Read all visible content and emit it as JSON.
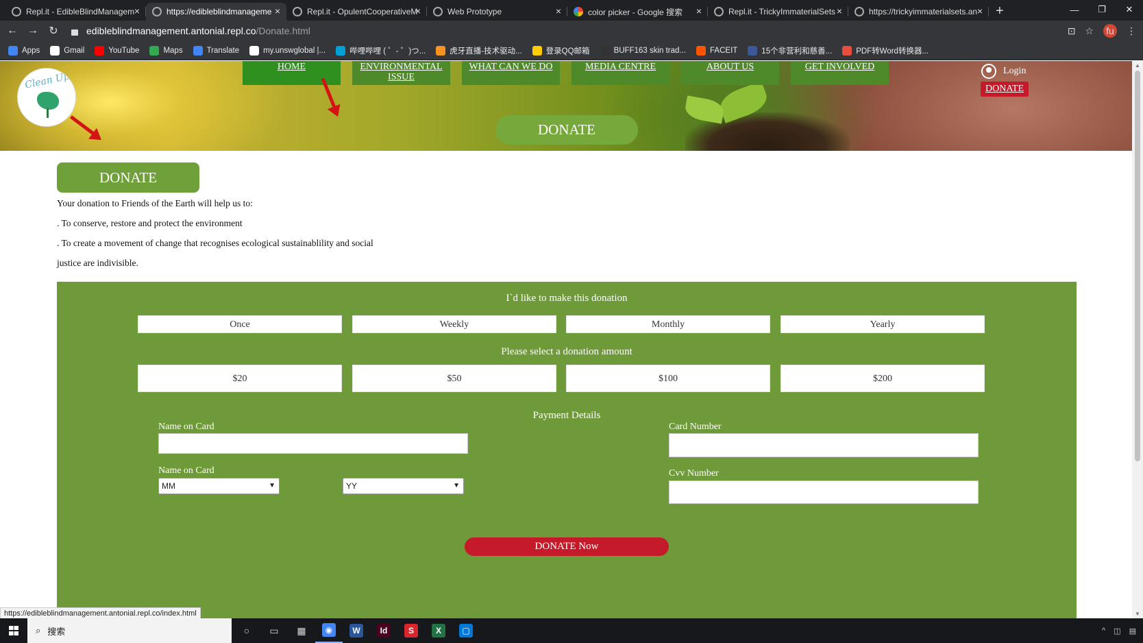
{
  "browser": {
    "tabs": [
      {
        "title": "Repl.it - EdibleBlindManagem",
        "active": false,
        "icon": "replit-icon"
      },
      {
        "title": "https://edibleblindmanageme",
        "active": true,
        "icon": "globe-icon"
      },
      {
        "title": "Repl.it - OpulentCooperativeM",
        "active": false,
        "icon": "replit-icon"
      },
      {
        "title": "Web Prototype",
        "active": false,
        "icon": "globe-icon"
      },
      {
        "title": "color picker - Google 搜索",
        "active": false,
        "icon": "google-icon"
      },
      {
        "title": "Repl.it - TrickyImmaterialSets",
        "active": false,
        "icon": "replit-icon"
      },
      {
        "title": "https://trickyimmaterialsets.an",
        "active": false,
        "icon": "globe-icon"
      }
    ],
    "new_tab_label": "+",
    "url_host": "edibleblindmanagement.antonial.repl.co",
    "url_path": "/Donate.html",
    "profile_initials": "fu",
    "bookmarks": [
      {
        "label": "Apps",
        "color": "#4285f4"
      },
      {
        "label": "Gmail",
        "color": "#ffffff"
      },
      {
        "label": "YouTube",
        "color": "#ff0000"
      },
      {
        "label": "Maps",
        "color": "#34a853"
      },
      {
        "label": "Translate",
        "color": "#4285f4"
      },
      {
        "label": "my.unswglobal |...",
        "color": "#ffffff"
      },
      {
        "label": "哔哩哔哩 ( ゜- ゜)つ...",
        "color": "#00a1d6"
      },
      {
        "label": "虎牙直播-技术驱动...",
        "color": "#f7931e"
      },
      {
        "label": "登录QQ邮箱",
        "color": "#ffcc00"
      },
      {
        "label": "BUFF163 skin trad...",
        "color": "#333333"
      },
      {
        "label": "FACEIT",
        "color": "#ff5500"
      },
      {
        "label": "15个非营利和慈善...",
        "color": "#3b5998"
      },
      {
        "label": "PDF转Word转换器...",
        "color": "#e94e3c"
      }
    ],
    "status_url": "https://edibleblindmanagement.antonial.repl.co/index.html"
  },
  "site": {
    "nav": [
      {
        "label": "HOME",
        "active": true
      },
      {
        "label": "ENVIRONMENTAL ISSUE",
        "active": false
      },
      {
        "label": "WHAT CAN WE DO",
        "active": false
      },
      {
        "label": "MEDIA CENTRE",
        "active": false
      },
      {
        "label": "ABOUT US",
        "active": false
      },
      {
        "label": "GET INVOLVED",
        "active": false
      }
    ],
    "logo_text": "Clean Up",
    "login_label": "Login",
    "donate_top_label": "DONATE",
    "hero_title": "DONATE",
    "section_title": "DONATE",
    "intro": [
      "Your donation to Friends of the Earth will help us to:",
      ". To conserve, restore and protect the environment",
      ". To create a movement of change that recognises ecological sustainablility and social",
      "justice are indivisible."
    ],
    "form": {
      "frequency_heading": "I`d like to make this donation",
      "frequencies": [
        "Once",
        "Weekly",
        "Monthly",
        "Yearly"
      ],
      "amount_heading": "Please select a donation amount",
      "amounts": [
        "$20",
        "$50",
        "$100",
        "$200"
      ],
      "payment_heading": "Payment Details",
      "name_label": "Name on Card",
      "name_value": "",
      "expiry_label": "Name on Card",
      "month_value": "MM",
      "year_value": "YY",
      "card_label": "Card Number",
      "card_value": "",
      "cvv_label": "Cvv Number",
      "cvv_value": "",
      "submit_label": "DONATE Now"
    },
    "colors": {
      "form_green": "#6f9a3a",
      "donate_red": "#c51a2a",
      "nav_green": "#4f8a2a"
    }
  },
  "taskbar": {
    "search_placeholder": "搜索",
    "apps": [
      {
        "name": "cortana-icon",
        "glyph": "○"
      },
      {
        "name": "taskview-icon",
        "glyph": "▭"
      },
      {
        "name": "store-icon",
        "glyph": "▦"
      },
      {
        "name": "chrome-icon",
        "glyph": "◉"
      },
      {
        "name": "word-icon",
        "glyph": "W"
      },
      {
        "name": "indesign-icon",
        "glyph": "Id"
      },
      {
        "name": "wps-icon",
        "glyph": "S"
      },
      {
        "name": "excel-icon",
        "glyph": "X"
      },
      {
        "name": "app-icon",
        "glyph": "▢"
      }
    ]
  }
}
